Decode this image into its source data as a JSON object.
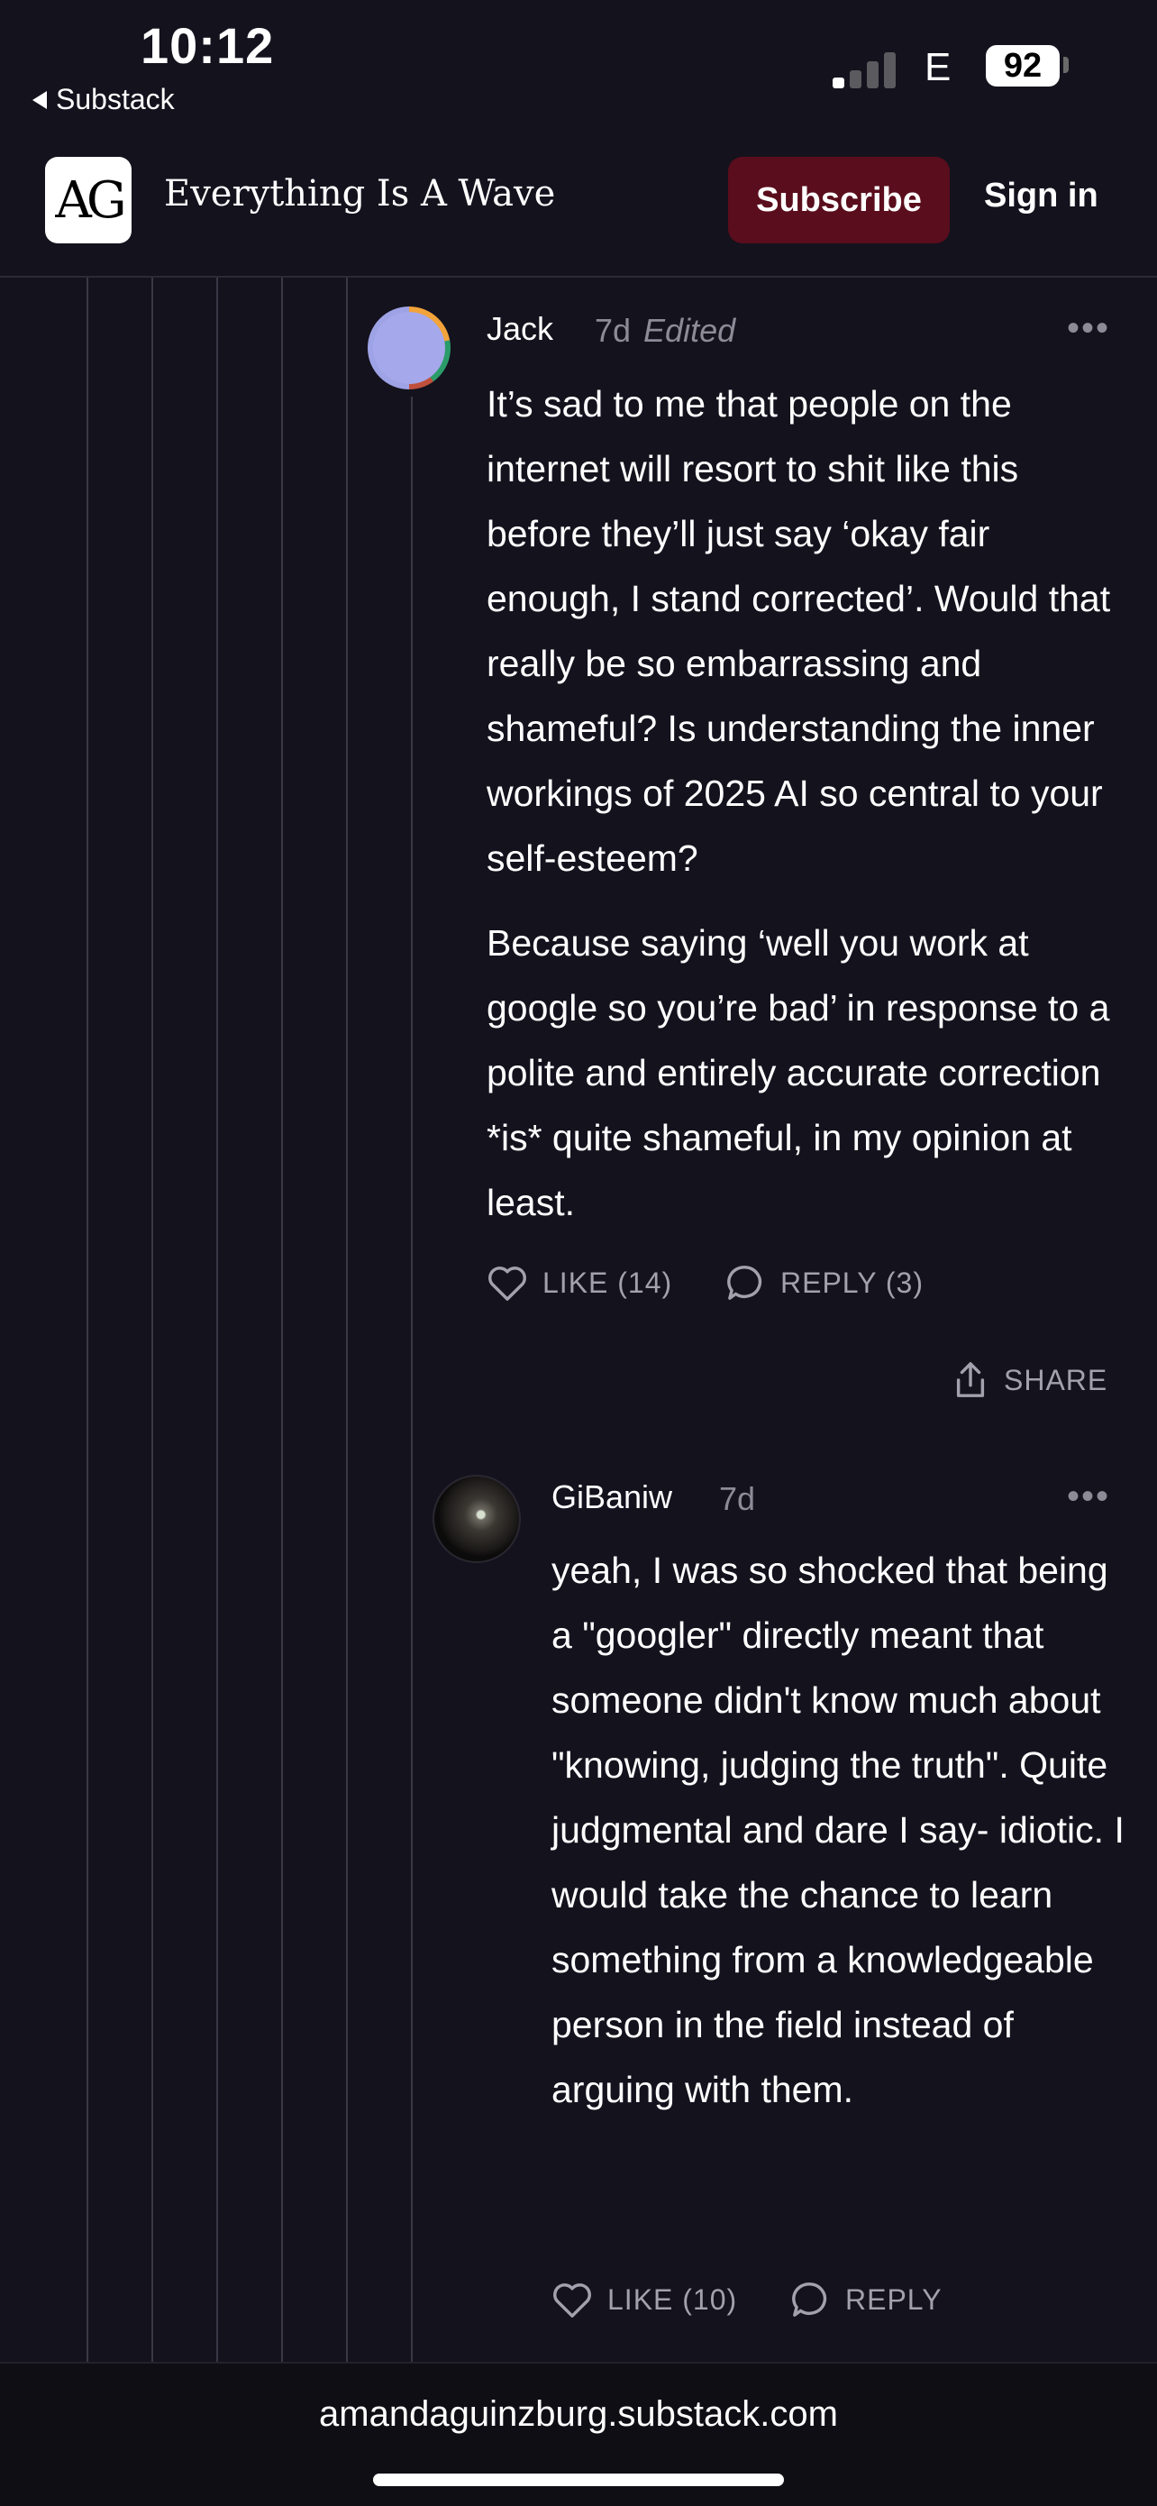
{
  "status_bar": {
    "time": "10:12",
    "back_app": "Substack",
    "network": "E",
    "battery": "92"
  },
  "header": {
    "logo_text": "AG",
    "title": "Everything Is A Wave",
    "subscribe_label": "Subscribe",
    "signin_label": "Sign in"
  },
  "comments": [
    {
      "author": "Jack",
      "time": "7d",
      "edited": "Edited",
      "paragraphs": [
        "It’s sad to me that people on the internet will resort to shit like this before they’ll just say ‘okay fair enough, I stand corrected’. Would that really be so embarrassing and shameful? Is understanding the inner workings of 2025 AI so central to your self-esteem?",
        "Because saying ‘well you work at google so you’re bad’ in response to a polite and entirely accurate correction *is* quite shameful, in my opinion at least."
      ],
      "like_label": "LIKE (14)",
      "reply_label": "REPLY (3)",
      "share_label": "SHARE"
    },
    {
      "author": "GiBaniw",
      "time": "7d",
      "paragraphs": [
        "yeah, I was so shocked that being a \"googler\" directly meant that someone didn't know much about \"knowing, judging the truth\". Quite judgmental and dare I say- idiotic. I would take the chance to learn something from a knowledgeable person in the field instead of arguing with them."
      ],
      "like_label": "LIKE (10)",
      "reply_label": "REPLY"
    }
  ],
  "footer": {
    "url": "amandaguinzburg.substack.com"
  },
  "colors": {
    "background": "#14121d",
    "subscribe_bg": "#5a0d1c",
    "muted_text": "#8d8b98",
    "thread_line": "#3a3845"
  }
}
